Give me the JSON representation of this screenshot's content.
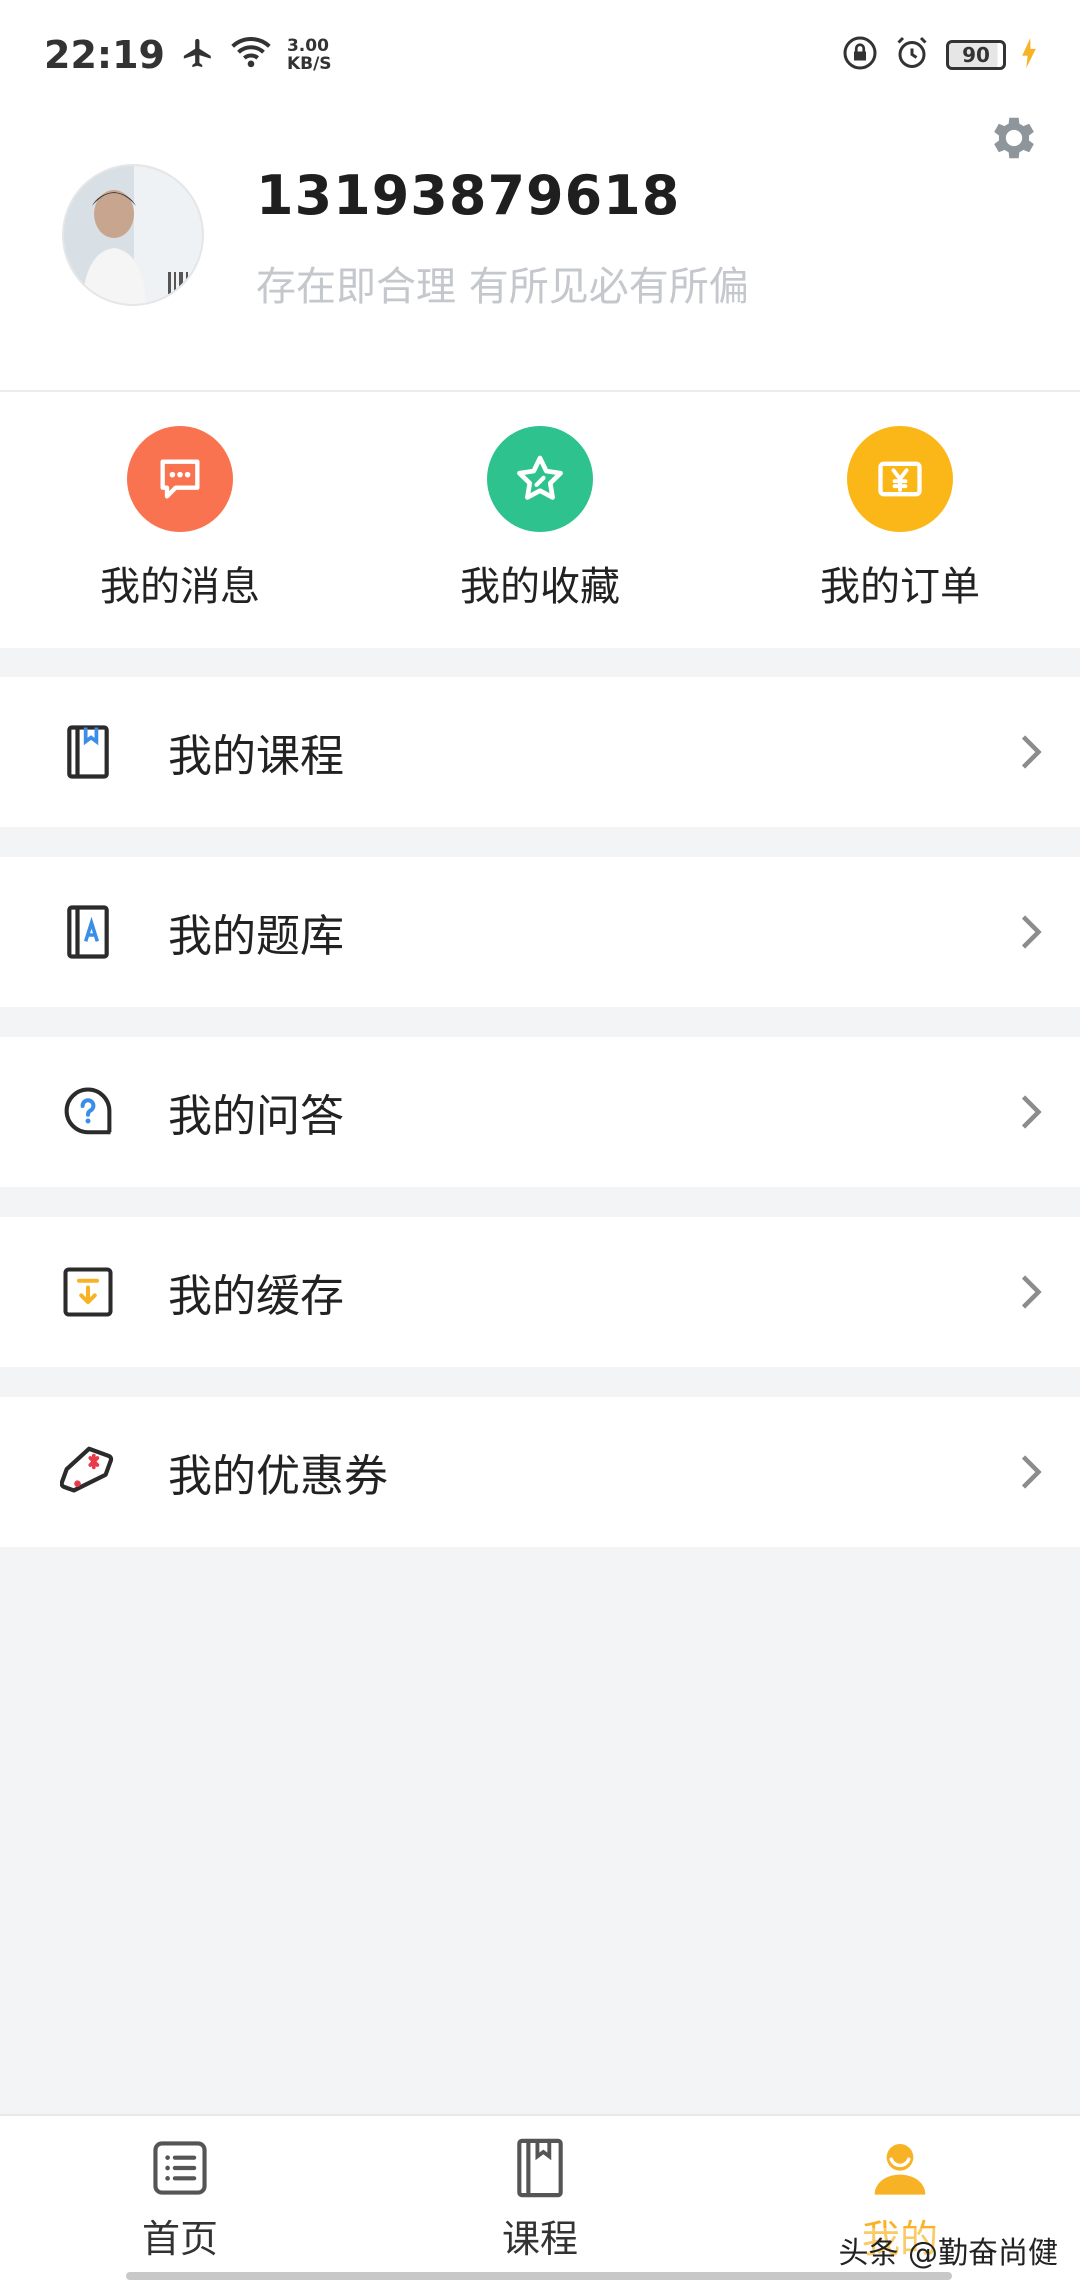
{
  "status_bar": {
    "time": "22:19",
    "net_speed_value": "3.00",
    "net_speed_unit": "KB/S",
    "battery": "90"
  },
  "profile": {
    "username": "13193879618",
    "motto": "存在即合理 有所见必有所偏"
  },
  "quick_actions": [
    {
      "label": "我的消息",
      "icon": "message-icon",
      "color": "#fa7350"
    },
    {
      "label": "我的收藏",
      "icon": "star-icon",
      "color": "#2ec28e"
    },
    {
      "label": "我的订单",
      "icon": "yen-order-icon",
      "color": "#fbb718"
    }
  ],
  "menu": [
    {
      "label": "我的课程",
      "icon": "course-book-icon"
    },
    {
      "label": "我的题库",
      "icon": "question-bank-icon"
    },
    {
      "label": "我的问答",
      "icon": "question-bubble-icon"
    },
    {
      "label": "我的缓存",
      "icon": "download-cache-icon"
    },
    {
      "label": "我的优惠券",
      "icon": "coupon-icon"
    }
  ],
  "bottom_nav": [
    {
      "label": "首页",
      "icon": "home-list-icon",
      "active": false
    },
    {
      "label": "课程",
      "icon": "course-book-icon",
      "active": false
    },
    {
      "label": "我的",
      "icon": "user-icon",
      "active": true
    }
  ],
  "watermark": "头条 @勤奋尚健",
  "colors": {
    "accent": "#f7b325",
    "background": "#f3f4f6",
    "blue_icon": "#3a8ee6",
    "red_icon": "#e83a4a"
  }
}
